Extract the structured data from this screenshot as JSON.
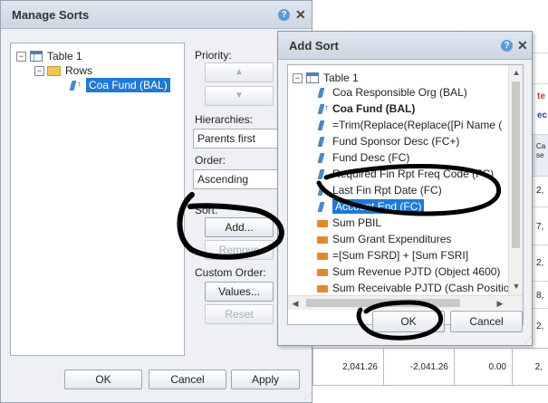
{
  "manage_sorts": {
    "title": "Manage Sorts",
    "tree": {
      "root": "Table 1",
      "rows": "Rows",
      "sorted_item": "Coa Fund (BAL)"
    },
    "priority_label": "Priority:",
    "up_arrow": "▲",
    "down_arrow": "▼",
    "hierarchies_label": "Hierarchies:",
    "hierarchies_value": "Parents first",
    "order_label": "Order:",
    "order_value": "Ascending",
    "sort_label": "Sort:",
    "add_button": "Add...",
    "remove_button": "Remove",
    "custom_order_label": "Custom Order:",
    "values_button": "Values...",
    "reset_button": "Reset",
    "ok_button": "OK",
    "cancel_button": "Cancel",
    "apply_button": "Apply"
  },
  "add_sort": {
    "title": "Add Sort",
    "root": "Table 1",
    "items": [
      {
        "label": "Coa Responsible Org (BAL)",
        "icon": "dimension-icon",
        "bold": false
      },
      {
        "label": "Coa Fund (BAL)",
        "icon": "sorted-dimension-icon",
        "bold": true
      },
      {
        "label": "=Trim(Replace(Replace([Pi Name (",
        "icon": "dimension-icon",
        "bold": false
      },
      {
        "label": "Fund Sponsor Desc (FC+)",
        "icon": "dimension-icon",
        "bold": false
      },
      {
        "label": "Fund Desc (FC)",
        "icon": "dimension-icon",
        "bold": false
      },
      {
        "label": "Required Fin Rpt Freq Code (FC)",
        "icon": "dimension-icon",
        "bold": false
      },
      {
        "label": "Last Fin Rpt Date (FC)",
        "icon": "dimension-icon",
        "bold": false
      },
      {
        "label": "Account End (FC)",
        "icon": "dimension-icon",
        "bold": false,
        "selected": true
      },
      {
        "label": "Sum PBIL",
        "icon": "measure-icon",
        "bold": false
      },
      {
        "label": "Sum Grant Expenditures",
        "icon": "measure-icon",
        "bold": false
      },
      {
        "label": "=[Sum FSRD] + [Sum FSRI]",
        "icon": "measure-icon",
        "bold": false
      },
      {
        "label": "Sum Revenue PJTD (Object 4600)",
        "icon": "measure-icon",
        "bold": false
      },
      {
        "label": "Sum Receivable PJTD (Cash Positio",
        "icon": "measure-icon",
        "bold": false
      }
    ],
    "ok_button": "OK",
    "cancel_button": "Cancel"
  },
  "background_sheet": {
    "right_col": [
      "te",
      "ec",
      "Ca",
      "se",
      "2,",
      "7,",
      "2,",
      "8,",
      "2,",
      "8,"
    ],
    "bottom_row": [
      "2,041.26",
      "-2,041.26",
      "0.00",
      "2,"
    ]
  },
  "colors": {
    "selection": "#1e7ad6",
    "accent_text": "#c0392b",
    "annotation_ink": "#000000"
  }
}
